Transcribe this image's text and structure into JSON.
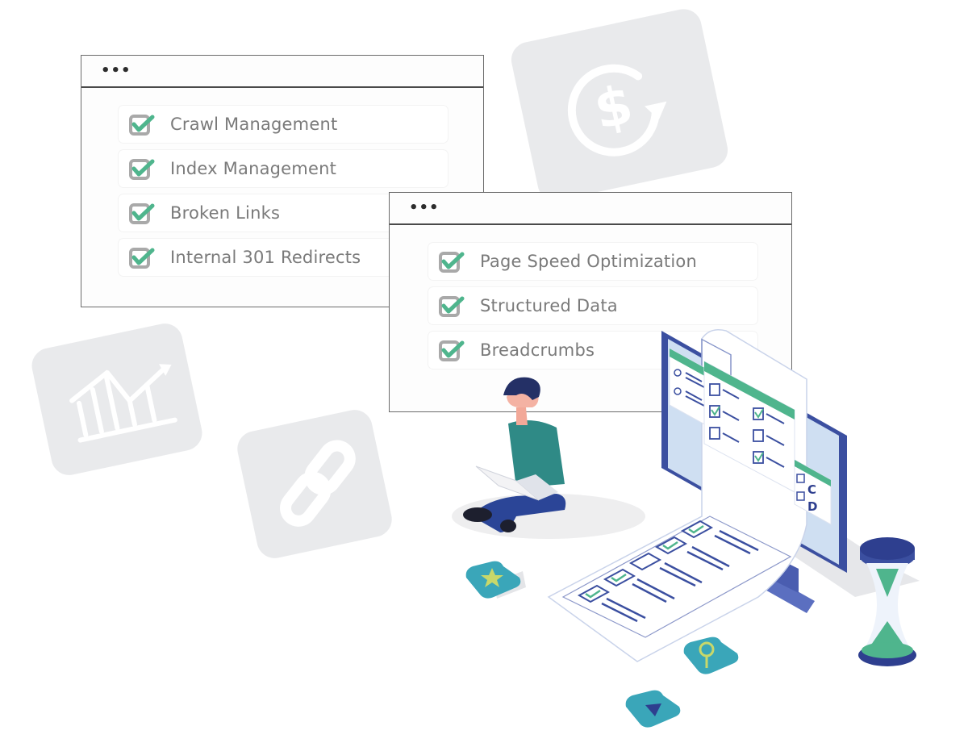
{
  "window_primary": {
    "menu_dots": "•••",
    "items": [
      {
        "label": "Crawl Management",
        "checked": true
      },
      {
        "label": "Index Management",
        "checked": true
      },
      {
        "label": "Broken Links",
        "checked": true
      },
      {
        "label": "Internal 301 Redirects",
        "checked": true
      }
    ]
  },
  "window_secondary": {
    "menu_dots": "•••",
    "items": [
      {
        "label": "Page Speed Optimization",
        "checked": true
      },
      {
        "label": "Structured Data",
        "checked": true
      },
      {
        "label": "Breadcrumbs",
        "checked": true
      }
    ]
  },
  "background_tiles": [
    {
      "icon": "dollar-refresh-icon"
    },
    {
      "icon": "growth-chart-icon"
    },
    {
      "icon": "link-chain-icon"
    }
  ],
  "illustration": {
    "answer_options": [
      "C",
      "D"
    ],
    "floating_buttons": [
      {
        "icon": "star-icon"
      },
      {
        "icon": "magnifier-icon"
      },
      {
        "icon": "play-icon"
      }
    ]
  },
  "colors": {
    "check_green": "#4fb58d",
    "checkbox_gray": "#a9a9a9",
    "label_gray": "#7a7a7a",
    "tile_gray": "#e9eaec",
    "navy": "#2e3f8f",
    "teal": "#3aa6b9",
    "sweater_teal": "#2f8a86"
  }
}
